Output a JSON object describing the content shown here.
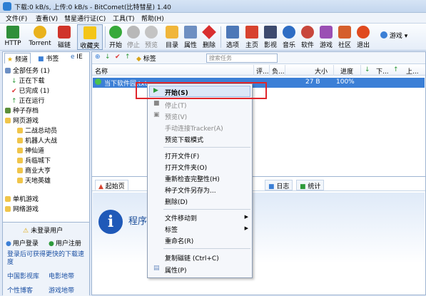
{
  "window": {
    "title": "下载:0 kB/s, 上传:0 kB/s - BitComet(比特彗星) 1.40"
  },
  "menu": [
    "文件(F)",
    "查看(V)",
    "彗星通行证(C)",
    "工具(T)",
    "帮助(H)"
  ],
  "toolbar": {
    "http": "HTTP",
    "torrent": "Torrent",
    "magnet": "磁链",
    "favorites": "收藏夹",
    "start": "开始",
    "stop": "停止",
    "preview": "预览",
    "catalog": "目录",
    "properties": "属性",
    "delete": "删除",
    "options": "选项",
    "home": "主页",
    "video": "影视",
    "music": "音乐",
    "software": "软件",
    "games": "游戏",
    "community": "社区",
    "exit": "退出",
    "game_dropdown": "游戏"
  },
  "left_tabs": {
    "channels": "频道",
    "bookmarks": "书签",
    "ie": "IE"
  },
  "tree": {
    "all_tasks": "全部任务 (1)",
    "downloading": "正在下载",
    "completed": "已完成 (1)",
    "running": "正在运行",
    "torrent_store": "种子存档",
    "web_games": "网页游戏",
    "g1": "二战总动员",
    "g2": "机器人大战",
    "g3": "神仙道",
    "g4": "兵临城下",
    "g5": "商业大亨",
    "g6": "天地英雄",
    "single_games": "单机游戏",
    "net_games": "网络游戏"
  },
  "login": {
    "not_logged": "未登录用户",
    "login": "用户登录",
    "register": "用户注册",
    "promo": "登录后可获得更快的下载速度",
    "link1": "中国影视库",
    "link2": "电影地带",
    "link3": "个性博客",
    "link4": "游戏地带"
  },
  "subtool": {
    "tags": "标签",
    "search_placeholder": "搜索任务"
  },
  "columns": {
    "name": "名称",
    "comment": "评...",
    "size": "大小",
    "progress": "进度"
  },
  "task": {
    "name": "当下软件园.txt",
    "size": "27 B",
    "progress": "100%"
  },
  "bottom_tabs": {
    "start_page": "起始页",
    "log": "日志",
    "stats": "统计"
  },
  "start_page": {
    "text": "程序"
  },
  "context_menu": {
    "start": "开始(S)",
    "stop": "停止(T)",
    "preview": "预览(V)",
    "connect": "手动连接Tracker(A)",
    "preview_mode": "预览下载模式",
    "open_file": "打开文件(F)",
    "open_folder": "打开文件夹(O)",
    "recheck": "重新检查完整性(H)",
    "save_torrent": "种子文件另存为...",
    "delete": "删除(D)",
    "move": "文件移动到",
    "tag": "标签",
    "rename": "重命名(R)",
    "copy_magnet": "复制磁链 (Ctrl+C)",
    "properties": "属性(P)"
  }
}
